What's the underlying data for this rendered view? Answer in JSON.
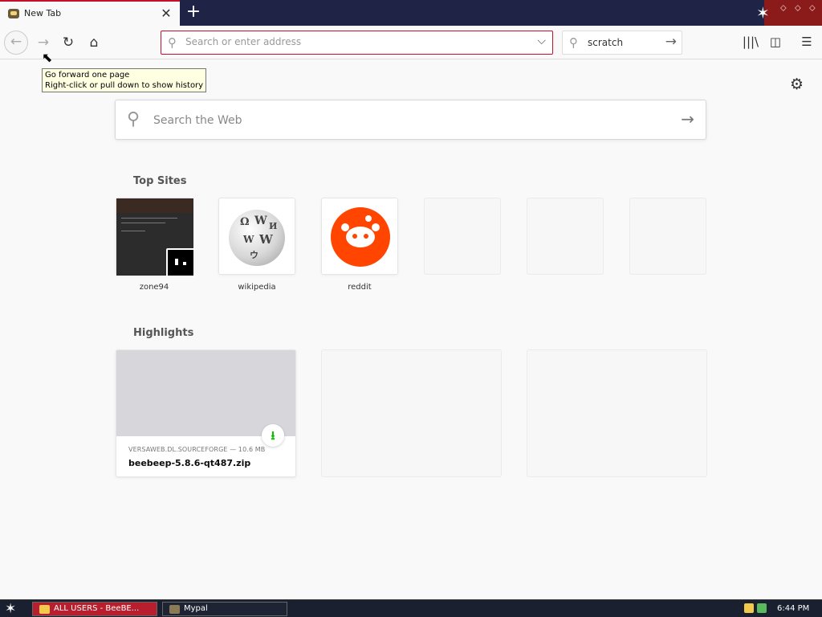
{
  "tab": {
    "title": "New Tab",
    "close_glyph": "✕"
  },
  "new_tab_glyph": "+",
  "window_controls": {
    "star": "✶",
    "minimize": "⬦",
    "restore": "⬦",
    "close": "⬦"
  },
  "nav": {
    "back_glyph": "←",
    "forward_glyph": "→",
    "reload_glyph": "↻",
    "home_glyph": "⌂",
    "url_placeholder": "Search or enter address",
    "url_dropdown_glyph": "⌵",
    "search_value": "scratch",
    "search_go_glyph": "→",
    "library_glyph": "|||\\",
    "sidebar_glyph": "◫",
    "menu_glyph": "☰"
  },
  "tooltip": {
    "line1": "Go forward one page",
    "line2": "Right-click or pull down to show history"
  },
  "settings_glyph": "⚙",
  "web_search": {
    "placeholder": "Search the Web",
    "go_glyph": "→"
  },
  "top_sites": {
    "heading": "Top Sites",
    "sites": [
      {
        "label": "zone94"
      },
      {
        "label": "wikipedia"
      },
      {
        "label": "reddit"
      }
    ]
  },
  "highlights": {
    "heading": "Highlights",
    "items": [
      {
        "meta": "VERSAWEB.DL.SOURCEFORGE — 10.6 MB",
        "title": "beebeep-5.8.6-qt487.zip",
        "badge_glyph": "⭳"
      }
    ]
  },
  "taskbar": {
    "start_glyph": "✶",
    "tasks": [
      {
        "label": "ALL USERS - BeeBE..."
      },
      {
        "label": "Mypal"
      }
    ],
    "clock": "6:44 PM"
  },
  "colors": {
    "accent": "#c3102b",
    "tabbar": "#1f2447",
    "reddit": "#ff4500",
    "download_green": "#12bc00"
  }
}
